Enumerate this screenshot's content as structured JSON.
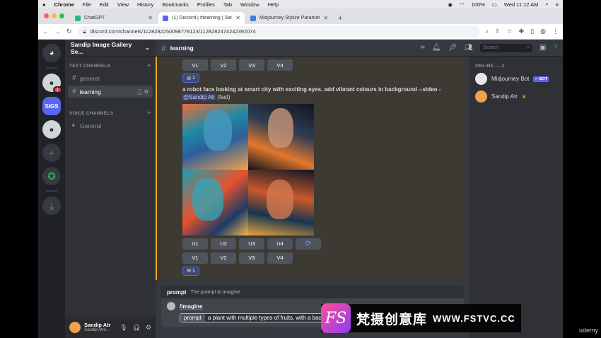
{
  "menubar": {
    "app": "Chrome",
    "items": [
      "File",
      "Edit",
      "View",
      "History",
      "Bookmarks",
      "Profiles",
      "Tab",
      "Window",
      "Help"
    ],
    "battery": "100%",
    "clock": "Wed 11:12 AM"
  },
  "browser": {
    "tabs": [
      {
        "label": "ChatGPT",
        "color": "#19c37d"
      },
      {
        "label": "(1) Discord | #learning | Sandip",
        "color": "#5865f2"
      },
      {
        "label": "Midjourney Stylize Parameter",
        "color": "#4a7bd0"
      }
    ],
    "url": "discord.com/channels/1128282250098778123/1128282474242392074"
  },
  "server": {
    "name": "Sandip Image Gallery Se...",
    "guilds": {
      "sigs": "SIGS",
      "badge": "1"
    },
    "categories": {
      "text": "TEXT CHANNELS",
      "voice": "VOICE CHANNELS"
    },
    "text_channels": [
      "general",
      "learning"
    ],
    "voice_channels": [
      "General"
    ]
  },
  "user": {
    "name": "Sandip Atr",
    "tag": "Sandip Atr#..."
  },
  "channel": {
    "name": "learning",
    "search_placeholder": "Search"
  },
  "message": {
    "top_buttons": [
      "V1",
      "V2",
      "V3",
      "V4"
    ],
    "reaction_count": "1",
    "prompt_text": "a robot face looking at smart city with exciting eyes. add vibrant colours in background --video -",
    "mention": "@Sandip Atr",
    "speed": "(fast)",
    "u_buttons": [
      "U1",
      "U2",
      "U3",
      "U4"
    ],
    "v_buttons": [
      "V1",
      "V2",
      "V3",
      "V4"
    ],
    "reaction_count_2": "1"
  },
  "members": {
    "header": "ONLINE — 2",
    "list": [
      {
        "name": "Midjourney Bot",
        "badge": "✓ BOT",
        "color": "#e6e6e6"
      },
      {
        "name": "Sandip Atr",
        "crown": "♛",
        "color": "#f0a14a"
      }
    ]
  },
  "composer": {
    "option_key": "prompt",
    "option_desc": "The prompt to imagine",
    "command": "/imagine",
    "field_key": "prompt",
    "field_value": "a plant with multiple types of fruits, with a background"
  },
  "watermark": {
    "cn": "梵摄创意库",
    "en": "WWW.FSTVC.CC",
    "logo": "FS",
    "corner": "udemy"
  }
}
